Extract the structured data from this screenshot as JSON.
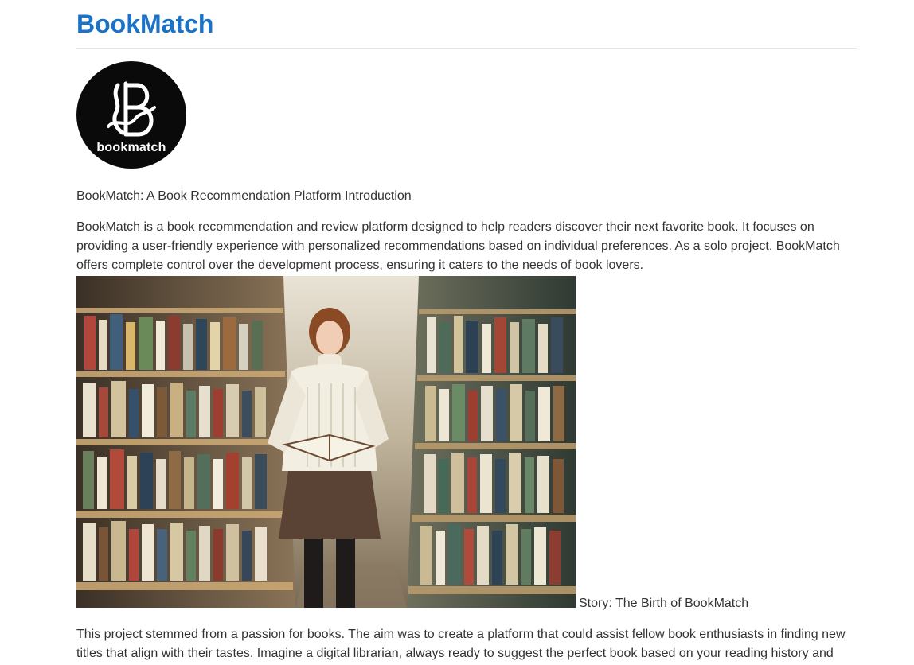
{
  "site": {
    "title": "BookMatch",
    "title_color": "#1a73c8"
  },
  "logo": {
    "icon": "bookmatch-b-logo",
    "text": "bookmatch"
  },
  "intro": {
    "caption": "BookMatch: A Book Recommendation Platform Introduction",
    "body": "BookMatch is a book recommendation and review platform designed to help readers discover their next favorite book. It focuses on providing a user-friendly experience with personalized recommendations based on individual preferences. As a solo project, BookMatch offers complete control over the development process, ensuring it caters to the needs of book lovers."
  },
  "photo": {
    "subject": "woman-reading-in-library-aisle"
  },
  "story": {
    "heading": "Story: The Birth of BookMatch",
    "body": "This project stemmed from a passion for books. The aim was to create a platform that could assist fellow book enthusiasts in finding new titles that align with their tastes. Imagine a digital librarian, always ready to suggest the perfect book based on your reading history and"
  }
}
